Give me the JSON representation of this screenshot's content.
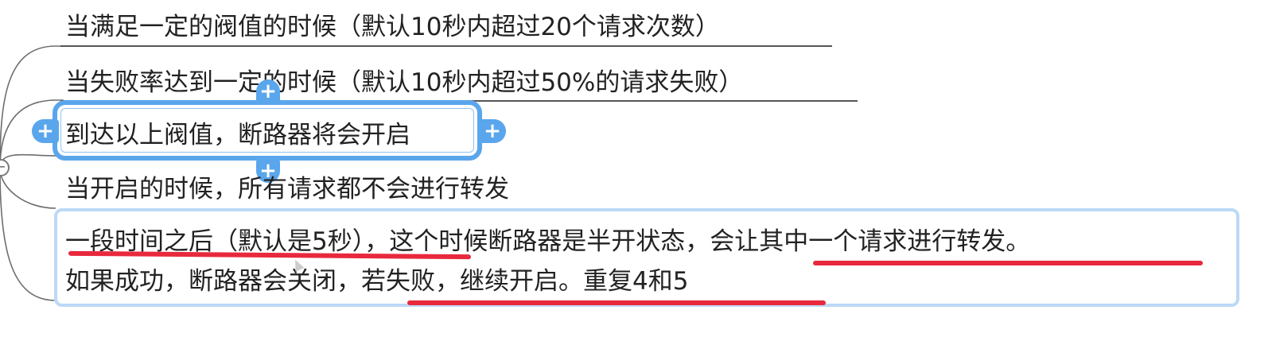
{
  "mindmap": {
    "topics": [
      {
        "text": "当满足一定的阀值的时候（默认10秒内超过20个请求次数）"
      },
      {
        "text": "当失败率达到一定的时候（默认10秒内超过50%的请求失败）"
      },
      {
        "text": "到达以上阀值，断路器将会开启"
      },
      {
        "text": "当开启的时候，所有请求都不会进行转发"
      },
      {
        "line1": "一段时间之后（默认是5秒），这个时候断路器是半开状态，会让其中一个请求进行转发。",
        "line2": "如果成功，断路器会关闭，若失败，继续开启。重复4和5"
      }
    ],
    "add_symbol": "+",
    "collapse_symbol": "−"
  },
  "colors": {
    "selection": "#5aa6ec",
    "highlight_border": "#bcd9f5",
    "red_underline": "#e8293d",
    "connector": "#6e6e6e"
  }
}
